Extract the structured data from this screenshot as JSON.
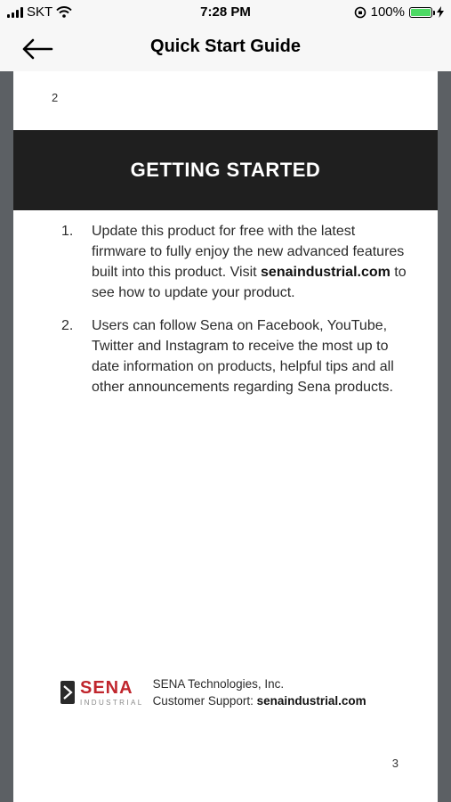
{
  "status_bar": {
    "carrier": "SKT",
    "time": "7:28 PM",
    "battery_percent": "100%",
    "battery_level": 1.0
  },
  "nav": {
    "title": "Quick Start Guide",
    "back_icon": "arrow-left-icon"
  },
  "page": {
    "top_page_number": "2",
    "banner_title": "GETTING STARTED",
    "steps": [
      {
        "num": "1.",
        "text_before": "Update this product for free with the latest firmware to fully enjoy the new advanced features built into this product. Visit ",
        "bold": "senaindustrial.com",
        "text_after": " to see how to update your product."
      },
      {
        "num": "2.",
        "text": "Users can follow Sena on Facebook, YouTube, Twitter and Instagram to receive the most up to date information on products, helpful tips and all other announcements regarding Sena products."
      }
    ],
    "footer": {
      "logo_brand": "SENA",
      "logo_sub": "INDUSTRIAL",
      "company": "SENA Technologies, Inc.",
      "support_label": "Customer Support: ",
      "support_site": "senaindustrial.com"
    },
    "bottom_page_number": "3"
  },
  "colors": {
    "banner_bg": "#1f1f1f",
    "brand_red": "#c0262d",
    "battery_green": "#4cd964"
  }
}
